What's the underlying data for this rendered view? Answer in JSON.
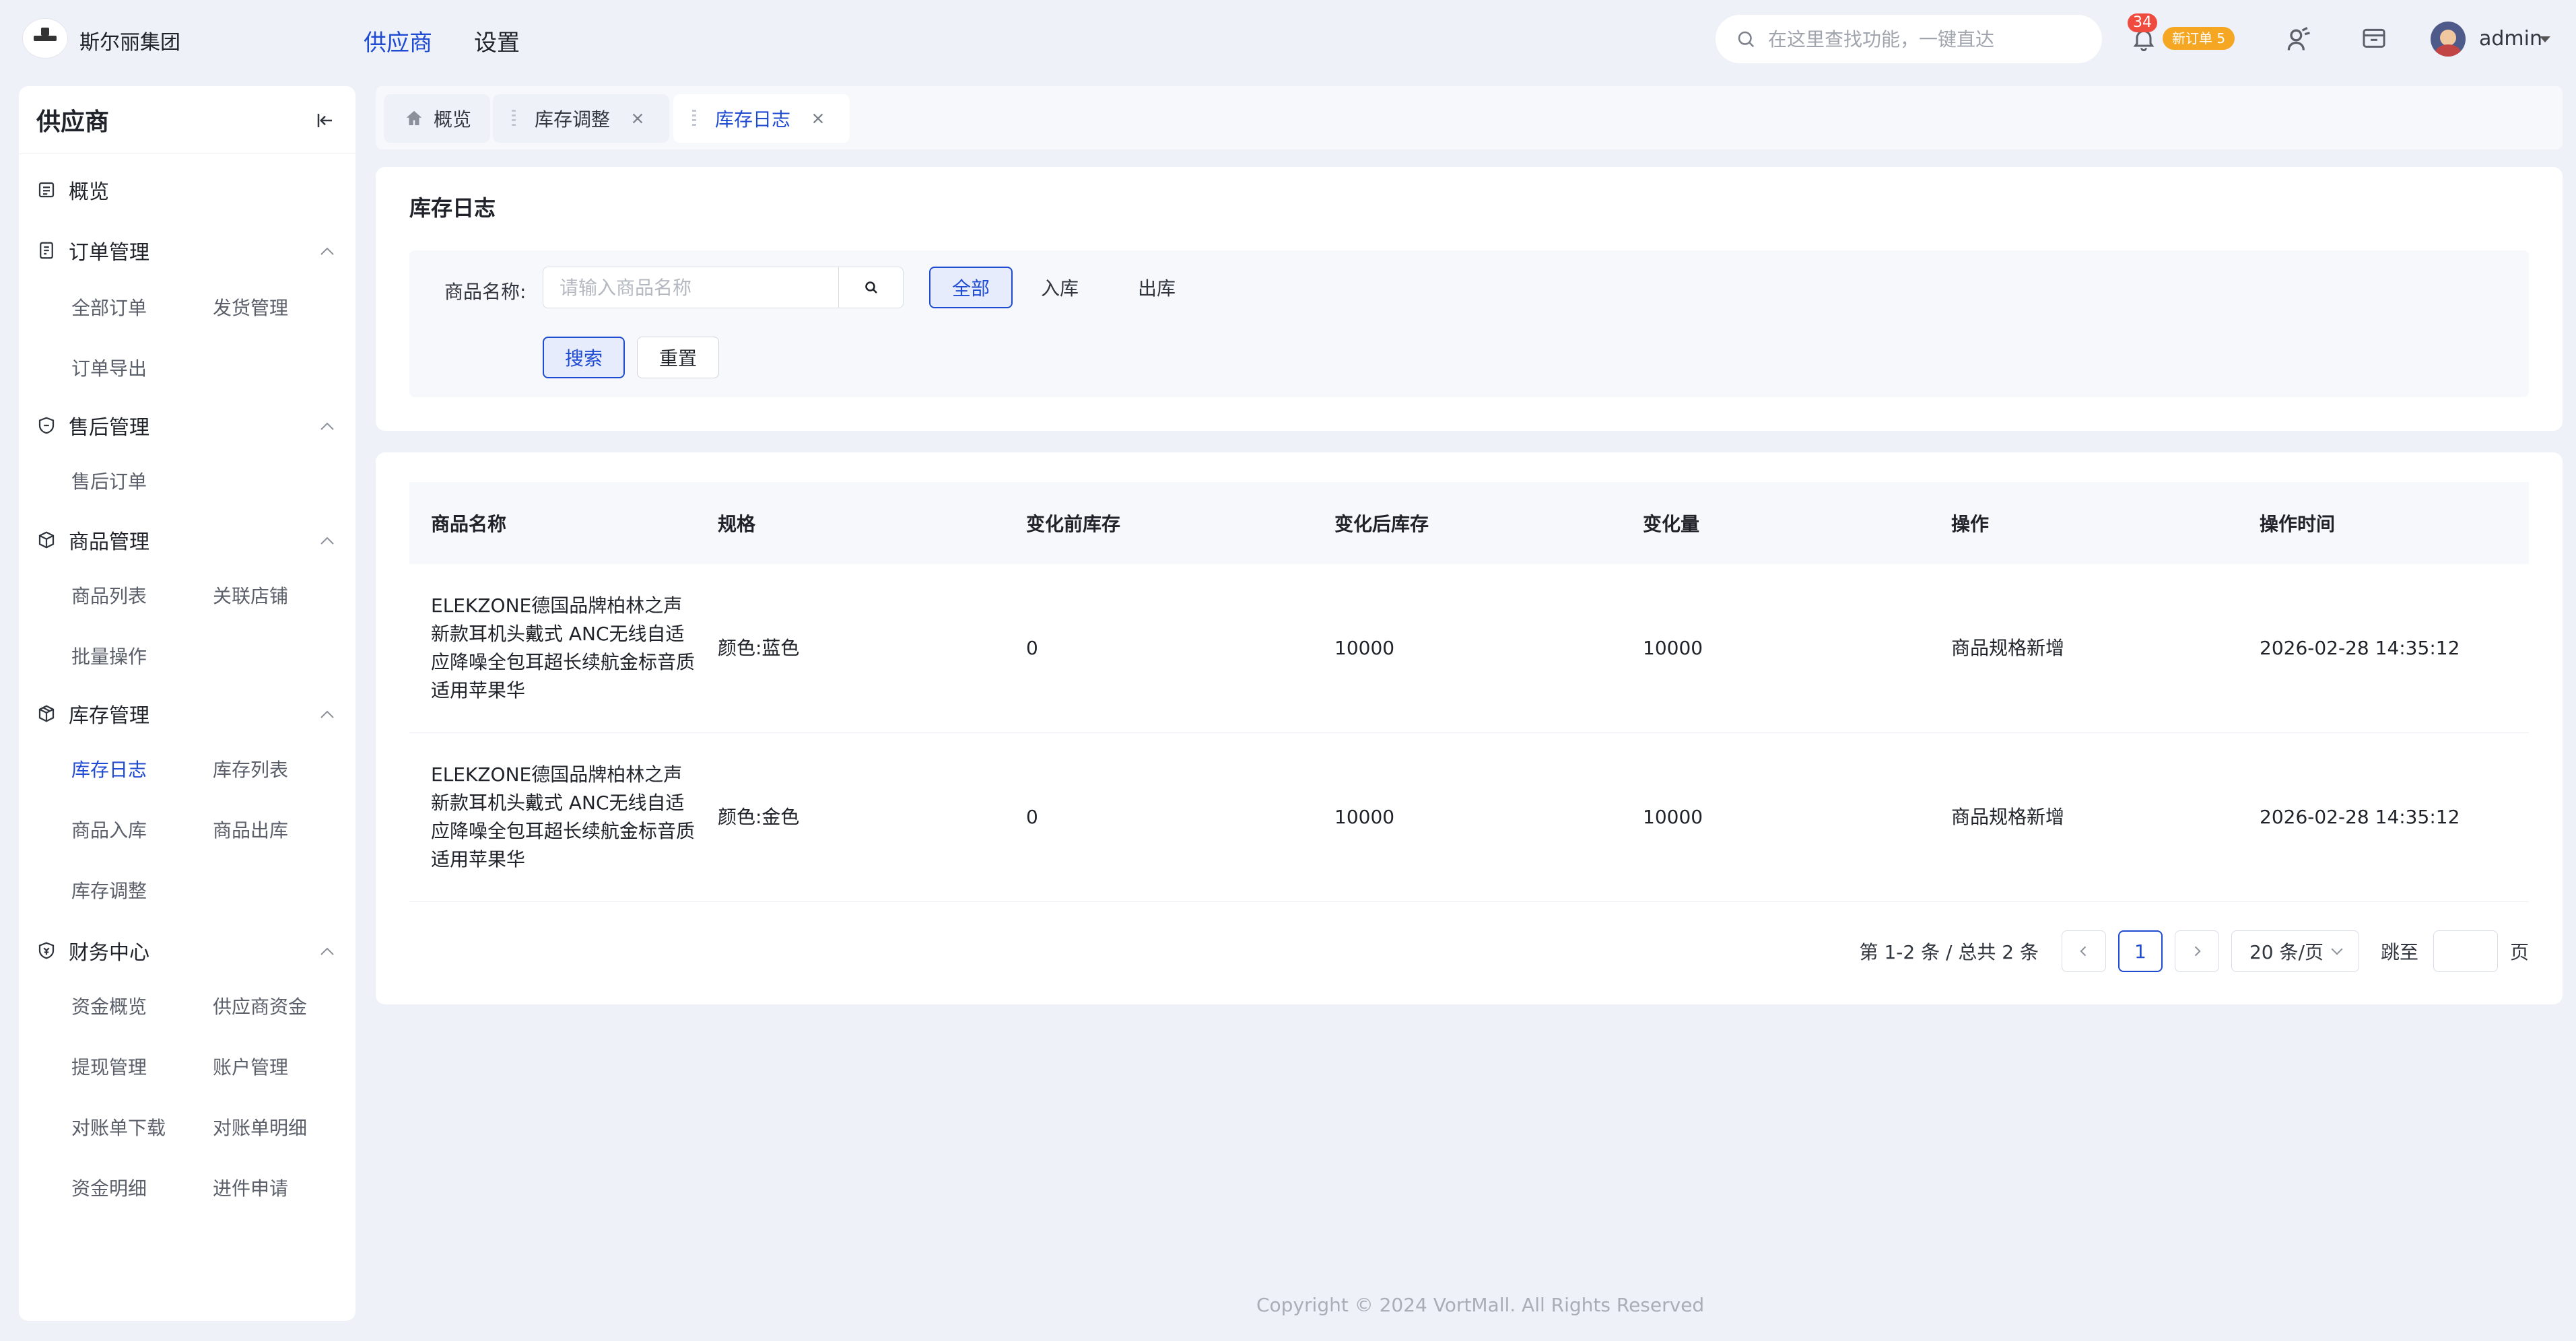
{
  "app": {
    "brand": "斯尔丽集团",
    "nav": [
      {
        "label": "供应商",
        "active": true
      },
      {
        "label": "设置",
        "active": false
      }
    ],
    "search_placeholder": "在这里查找功能，一键直达",
    "notification_count": "34",
    "new_order_tag": "新订单 5",
    "user": "admin"
  },
  "sidebar": {
    "title": "供应商",
    "overview": "概览",
    "groups": [
      {
        "label": "订单管理",
        "items": [
          "全部订单",
          "发货管理",
          "订单导出"
        ]
      },
      {
        "label": "售后管理",
        "items": [
          "售后订单"
        ]
      },
      {
        "label": "商品管理",
        "items": [
          "商品列表",
          "关联店铺",
          "批量操作"
        ]
      },
      {
        "label": "库存管理",
        "items": [
          "库存日志",
          "库存列表",
          "商品入库",
          "商品出库",
          "库存调整"
        ],
        "active_item": "库存日志"
      },
      {
        "label": "财务中心",
        "items": [
          "资金概览",
          "供应商资金",
          "提现管理",
          "账户管理",
          "对账单下载",
          "对账单明细",
          "资金明细",
          "进件申请"
        ]
      }
    ]
  },
  "tabs": [
    {
      "label": "概览",
      "active": false
    },
    {
      "label": "库存调整",
      "active": false
    },
    {
      "label": "库存日志",
      "active": true
    }
  ],
  "filter": {
    "title": "库存日志",
    "name_label": "商品名称:",
    "name_placeholder": "请输入商品名称",
    "segments": [
      "全部",
      "入库",
      "出库"
    ],
    "active_segment": "全部",
    "search_button": "搜索",
    "reset_button": "重置"
  },
  "table": {
    "columns": [
      "商品名称",
      "规格",
      "变化前库存",
      "变化后库存",
      "变化量",
      "操作",
      "操作时间"
    ],
    "rows": [
      [
        "ELEKZONE德国品牌柏林之声新款耳机头戴式 ANC无线自适应降噪全包耳超长续航金标音质适用苹果华",
        "颜色:蓝色",
        "0",
        "10000",
        "10000",
        "商品规格新增",
        "2026-02-28 14:35:12"
      ],
      [
        "ELEKZONE德国品牌柏林之声新款耳机头戴式 ANC无线自适应降噪全包耳超长续航金标音质适用苹果华",
        "颜色:金色",
        "0",
        "10000",
        "10000",
        "商品规格新增",
        "2026-02-28 14:35:12"
      ]
    ]
  },
  "pagination": {
    "total_text": "第 1-2 条 / 总共 2 条",
    "current_page": "1",
    "page_size": "20 条/页",
    "jump_label": "跳至",
    "page_suffix": "页"
  },
  "footer": {
    "copyright": "Copyright © 2024 VortMall. All Rights Reserved"
  },
  "colors": {
    "accent": "#1f4bd2",
    "badge": "#ef4b3f",
    "order_tag": "#f5a623",
    "background": "#eef1f8"
  }
}
